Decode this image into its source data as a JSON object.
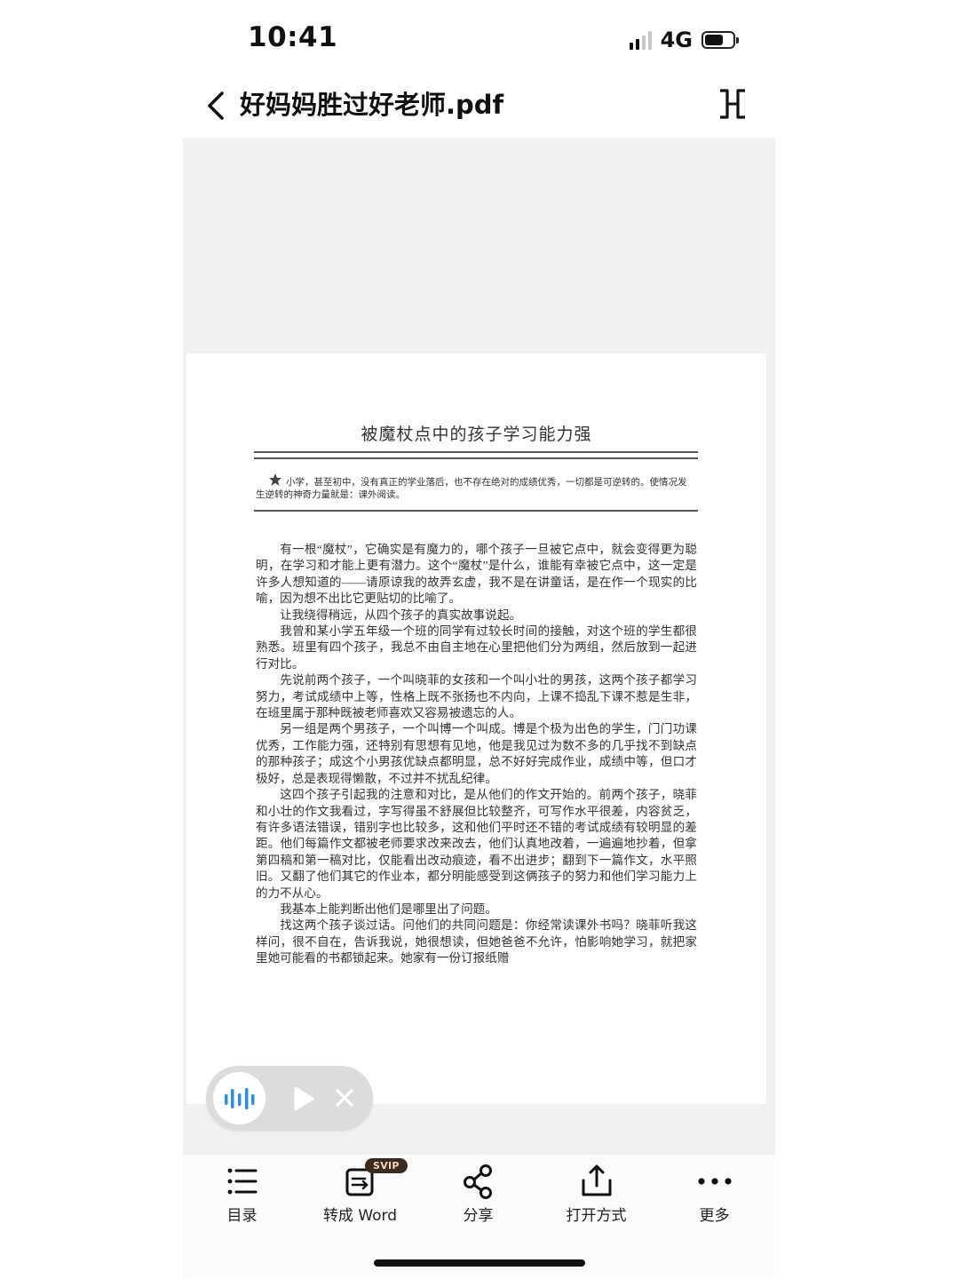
{
  "status_bar": {
    "time": "10:41",
    "network": "4G"
  },
  "header": {
    "title": "好妈妈胜过好老师.pdf"
  },
  "pdf_page": {
    "heading": "被魔杖点中的孩子学习能力强",
    "intro": "小学，甚至初中，没有真正的学业落后，也不存在绝对的成绩优秀，一切都是可逆转的。使情况发生逆转的神奇力量就是：课外阅读。",
    "paragraphs": [
      "有一根“魔杖”，它确实是有魔力的，哪个孩子一旦被它点中，就会变得更为聪明，在学习和才能上更有潜力。这个“魔杖”是什么，谁能有幸被它点中，这一定是许多人想知道的——请原谅我的故弄玄虚，我不是在讲童话，是在作一个现实的比喻，因为想不出比它更贴切的比喻了。",
      "让我绕得稍远，从四个孩子的真实故事说起。",
      "我曾和某小学五年级一个班的同学有过较长时间的接触，对这个班的学生都很熟悉。班里有四个孩子，我总不由自主地在心里把他们分为两组，然后放到一起进行对比。",
      "先说前两个孩子，一个叫晓菲的女孩和一个叫小壮的男孩，这两个孩子都学习努力，考试成绩中上等，性格上既不张扬也不内向，上课不捣乱下课不惹是生非，在班里属于那种既被老师喜欢又容易被遗忘的人。",
      "另一组是两个男孩子，一个叫博一个叫成。博是个极为出色的学生，门门功课优秀，工作能力强，还特别有思想有见地，他是我见过为数不多的几乎找不到缺点的那种孩子；成这个小男孩优缺点都明显，总不好好完成作业，成绩中等，但口才极好，总是表现得懒散，不过并不扰乱纪律。",
      "这四个孩子引起我的注意和对比，是从他们的作文开始的。前两个孩子，晓菲和小壮的作文我看过，字写得虽不舒展但比较整齐，可写作水平很差，内容贫乏，有许多语法错误，错别字也比较多，这和他们平时还不错的考试成绩有较明显的差距。他们每篇作文都被老师要求改来改去，他们认真地改着，一遍遍地抄着，但拿第四稿和第一稿对比，仅能看出改动痕迹，看不出进步；翻到下一篇作文，水平照旧。又翻了他们其它的作业本，都分明能感受到这俩孩子的努力和他们学习能力上的力不从心。",
      "我基本上能判断出他们是哪里出了问题。",
      "找这两个孩子谈过话。问他们的共同问题是：你经常读课外书吗？晓菲听我这样问，很不自在，告诉我说，她很想读，但她爸爸不允许，怕影响她学习，就把家里她可能看的书都锁起来。她家有一份订报纸赠"
    ]
  },
  "toolbar": {
    "items": [
      {
        "label": "目录",
        "icon": "list-icon"
      },
      {
        "label": "转成 Word",
        "icon": "convert-word-icon",
        "badge": "SVIP"
      },
      {
        "label": "分享",
        "icon": "share-icon"
      },
      {
        "label": "打开方式",
        "icon": "open-with-icon"
      },
      {
        "label": "更多",
        "icon": "more-icon"
      }
    ]
  }
}
